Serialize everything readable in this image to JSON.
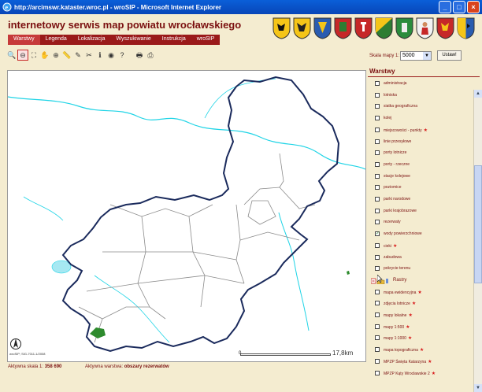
{
  "window": {
    "title": "http://arcimswr.kataster.wroc.pl - wroSIP - Microsoft Internet Explorer",
    "minimize": "_",
    "maximize": "□",
    "close": "×"
  },
  "header": {
    "site_title": "internetowy serwis map powiatu wrocławskiego"
  },
  "nav": {
    "tabs": [
      "Warstwy",
      "Legenda",
      "Lokalizacja",
      "Wyszukiwanie",
      "Instrukcja",
      "wroSIP"
    ],
    "active_index": 0
  },
  "toolbar": {
    "tools": [
      "zoom-in-icon",
      "zoom-out-icon",
      "full-extent-icon",
      "pan-hand-icon",
      "zoom-layer-icon",
      "measure-icon",
      "query-icon",
      "select-icon",
      "info-icon",
      "identify-icon",
      "help-icon",
      "print-icon",
      "export-icon",
      "save-icon"
    ]
  },
  "scale": {
    "label": "Skala mapy 1:",
    "value": "5000",
    "apply_label": "Ustaw!"
  },
  "map": {
    "caption": "wroSIP; SIG-7011-1/2008",
    "scalebar_zero": "0",
    "scalebar_end": "17,8km",
    "colors": {
      "boundary": "#1a2a5c",
      "gminy": "#888888",
      "water": "#1fd4e6",
      "forest": "#2e8b2e"
    }
  },
  "status": {
    "scale_label": "Aktywna skala 1:",
    "scale_value": "358 690",
    "layer_label": "Aktywna warstwa:",
    "layer_value": "obszary rezerwatów"
  },
  "panel": {
    "title": "Warstwy",
    "layers": [
      {
        "label": "administracja",
        "checked": false,
        "star": false
      },
      {
        "label": "lotniska",
        "checked": false,
        "star": false
      },
      {
        "label": "siatka geograficzna",
        "checked": false,
        "star": false
      },
      {
        "label": "kolej",
        "checked": false,
        "star": false
      },
      {
        "label": "miejscowości - punkty",
        "checked": false,
        "star": true
      },
      {
        "label": "linie przesyłowe",
        "checked": false,
        "star": false
      },
      {
        "label": "porty lotnicze",
        "checked": false,
        "star": false
      },
      {
        "label": "porty - rzeczne",
        "checked": false,
        "star": false
      },
      {
        "label": "stacje kolejowe",
        "checked": false,
        "star": false
      },
      {
        "label": "poziomice",
        "checked": false,
        "star": false
      },
      {
        "label": "parki narodowe",
        "checked": false,
        "star": false
      },
      {
        "label": "parki krajobrazowe",
        "checked": false,
        "star": false
      },
      {
        "label": "rezerwaty",
        "checked": false,
        "star": false
      },
      {
        "label": "wody powierzchniowe",
        "checked": true,
        "star": false
      },
      {
        "label": "cieki",
        "checked": false,
        "star": true
      },
      {
        "label": "zabudowa",
        "checked": false,
        "star": false
      },
      {
        "label": "pokrycie terenu",
        "checked": false,
        "star": false
      }
    ],
    "group_label": "Rastry",
    "rasters": [
      {
        "label": "mapa ewidencyjna",
        "star": true
      },
      {
        "label": "zdjęcia lotnicze",
        "star": true
      },
      {
        "label": "mapy lokalne",
        "star": true
      },
      {
        "label": "mapy 1:500",
        "star": true
      },
      {
        "label": "mapy 1:1000",
        "star": true
      },
      {
        "label": "mapa topograficzna",
        "star": true
      },
      {
        "label": "MPZP Święta Katarzyna",
        "star": true
      },
      {
        "label": "MPZP Kąty Wrocławskie 2",
        "star": true
      }
    ]
  }
}
